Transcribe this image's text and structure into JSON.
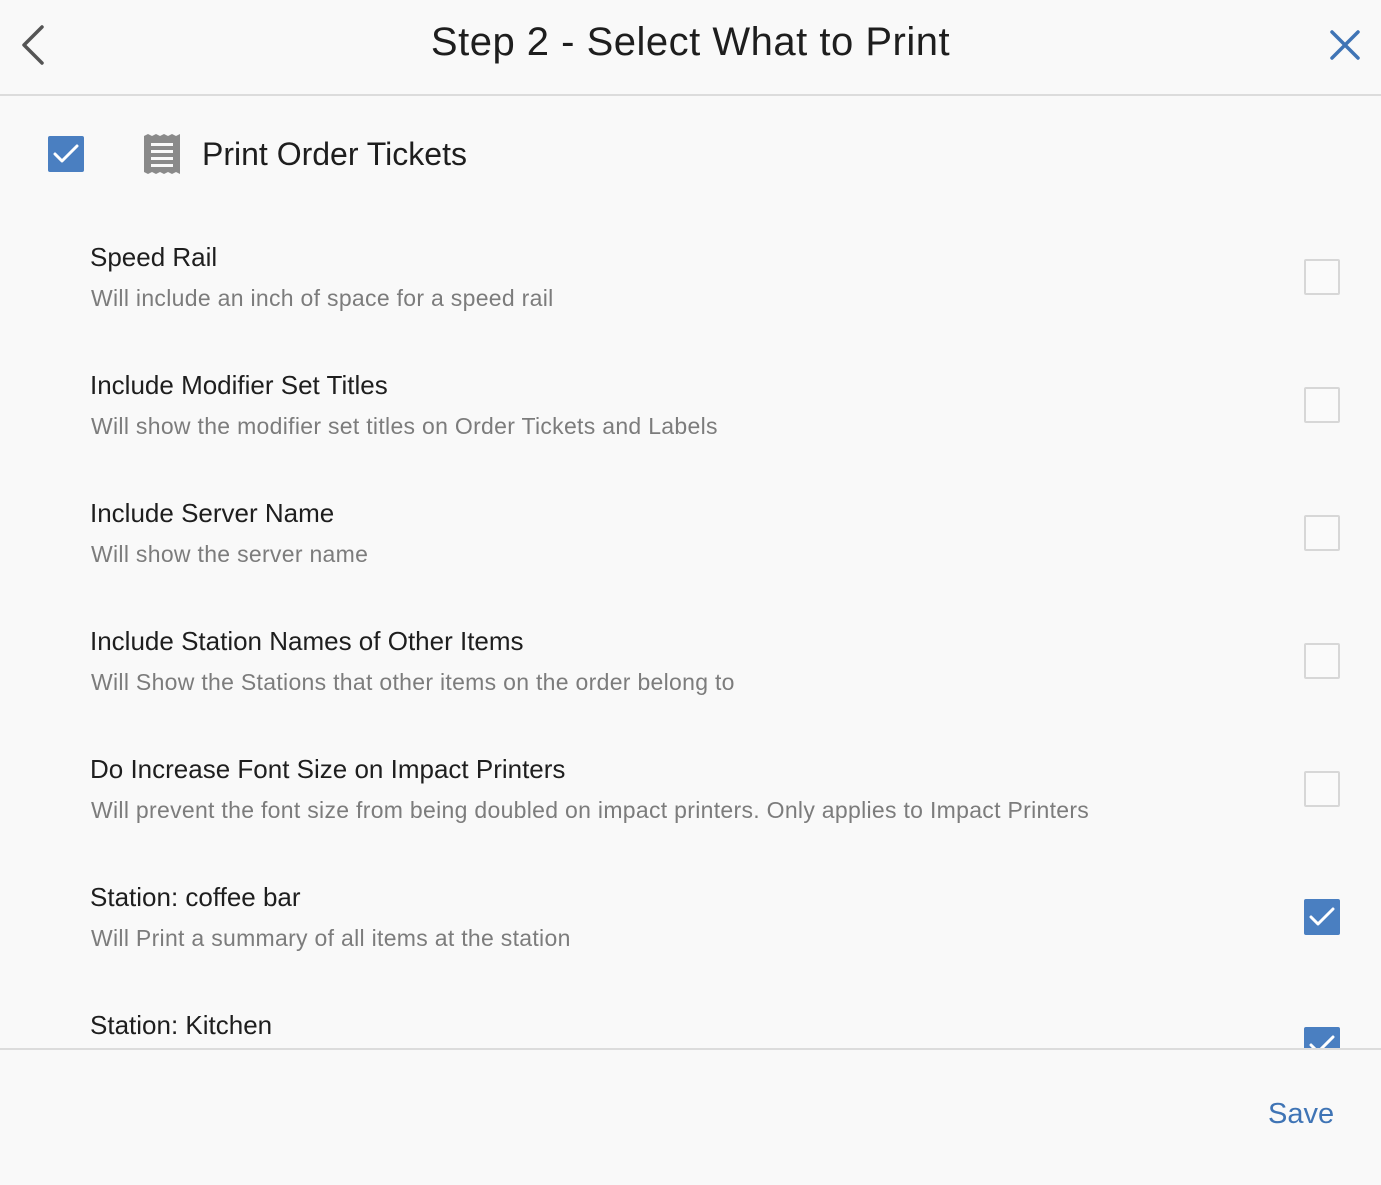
{
  "header": {
    "title": "Step 2 - Select What to Print",
    "back_icon": "chevron-left-icon",
    "close_icon": "close-icon"
  },
  "master": {
    "label": "Print Order Tickets",
    "checked": true,
    "icon": "receipt-icon"
  },
  "options": [
    {
      "title": "Speed Rail",
      "description": "Will include an inch of space for a speed rail",
      "checked": false
    },
    {
      "title": "Include Modifier Set Titles",
      "description": "Will show the modifier set titles on Order Tickets and Labels",
      "checked": false
    },
    {
      "title": "Include Server Name",
      "description": "Will show the server name",
      "checked": false
    },
    {
      "title": "Include Station Names of Other Items",
      "description": "Will Show the Stations that other items on the order belong to",
      "checked": false
    },
    {
      "title": "Do Increase Font Size on Impact Printers",
      "description": "Will prevent the font size from being doubled on impact printers.  Only applies to Impact Printers",
      "checked": false
    },
    {
      "title": "Station: coffee bar",
      "description": "Will Print a summary of all items at the station",
      "checked": true
    },
    {
      "title": "Station: Kitchen",
      "description": "",
      "checked": true
    }
  ],
  "footer": {
    "save_label": "Save"
  },
  "colors": {
    "accent": "#4a7fc1",
    "link": "#3f74b5",
    "text_primary": "#1e1e1e",
    "text_secondary": "#7c7c7c"
  }
}
